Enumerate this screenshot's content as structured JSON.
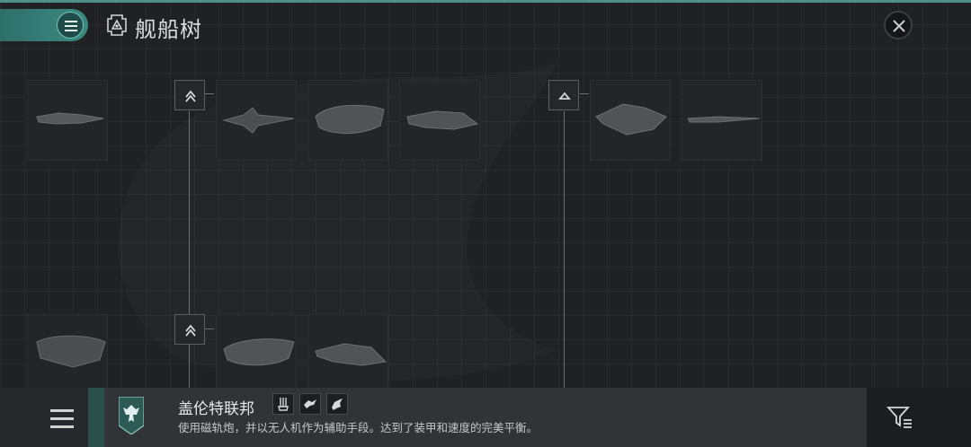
{
  "header": {
    "title": "舰船树",
    "title_icon": "ship-tree-icon",
    "menu_icon": "list-icon",
    "close_icon": "close-icon"
  },
  "tree": {
    "rows": [
      {
        "cards": [
          {
            "ship": "ship-silhouette-1"
          },
          {
            "ship": "ship-silhouette-2"
          },
          {
            "ship": "ship-silhouette-3"
          },
          {
            "ship": "ship-silhouette-4"
          },
          {
            "ship": "ship-silhouette-5"
          },
          {
            "ship": "ship-silhouette-6"
          }
        ]
      },
      {
        "cards": [
          {
            "ship": "ship-silhouette-7"
          },
          {
            "ship": "ship-silhouette-8"
          },
          {
            "ship": "ship-silhouette-9"
          }
        ]
      }
    ],
    "upgrade_icons": [
      "chevron-up-double-icon",
      "triangle-up-icon",
      "chevron-up-double-icon"
    ]
  },
  "footer": {
    "menu_icon": "hamburger-icon",
    "faction": {
      "name": "盖伦特联邦",
      "description": "使用磁轨炮，并以无人机作为辅助手段。达到了装甲和速度的完美平衡。",
      "emblem_icon": "eagle-emblem-icon",
      "tags": [
        "railgun-icon",
        "drone-icon",
        "bird-icon"
      ]
    },
    "filter_icon": "filter-icon"
  },
  "colors": {
    "accent": "#3b8a82",
    "background": "#1f2123",
    "bar": "#26292b"
  }
}
